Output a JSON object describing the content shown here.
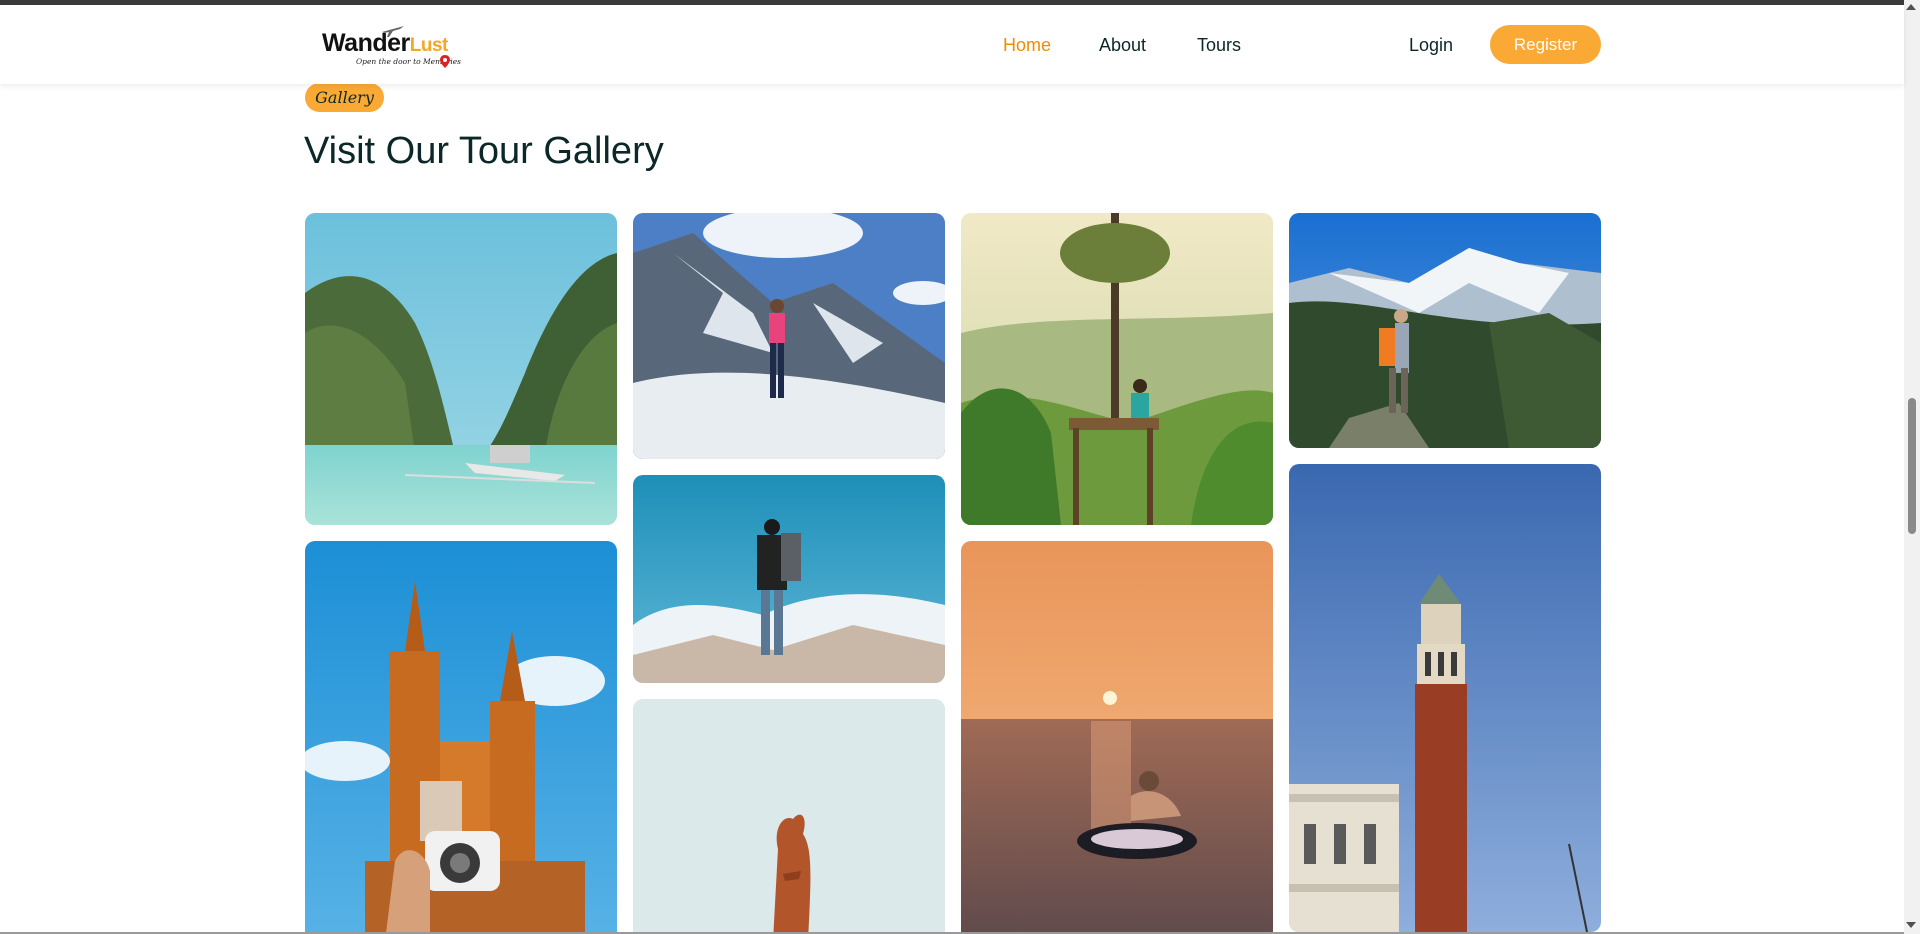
{
  "header": {
    "logo": {
      "brand_part1": "Wander",
      "brand_part2": "Lust",
      "tagline": "Open the door to Memories"
    },
    "nav": [
      {
        "label": "Home",
        "active": true
      },
      {
        "label": "About",
        "active": false
      },
      {
        "label": "Tours",
        "active": false
      }
    ],
    "login_label": "Login",
    "register_label": "Register"
  },
  "gallery": {
    "badge": "Gallery",
    "title": "Visit Our Tour Gallery",
    "images": [
      {
        "name": "lagoon-boat-photo"
      },
      {
        "name": "snow-mountain-climber-photo"
      },
      {
        "name": "backpacker-above-clouds-photo"
      },
      {
        "name": "desert-rock-spire-photo"
      },
      {
        "name": "treehouse-valley-photo"
      },
      {
        "name": "sunset-sea-float-photo"
      },
      {
        "name": "hiker-orange-backpack-mountains-photo"
      },
      {
        "name": "bell-tower-photo"
      },
      {
        "name": "cathedral-camera-photo"
      }
    ]
  },
  "colors": {
    "accent": "#faa935",
    "active_nav": "#f08c00",
    "heading": "#0b2727"
  }
}
